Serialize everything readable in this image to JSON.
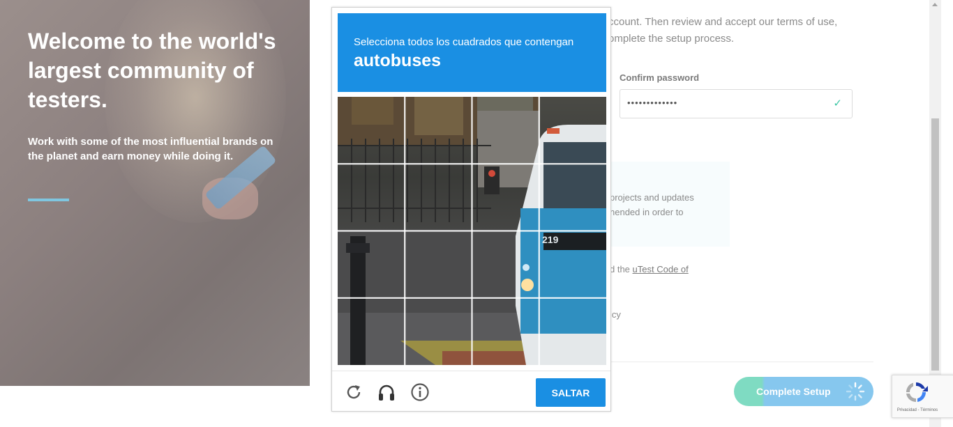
{
  "hero": {
    "title": "Welcome to the world's largest community of testers.",
    "subtitle": "Work with some of the most influential brands on the planet and earn money while doing it."
  },
  "form": {
    "intro_line1": "ccount. Then review and accept our terms of use,",
    "intro_line2": "omplete the setup process.",
    "confirm_password_label": "Confirm password",
    "confirm_password_value": "•••••••••••••",
    "info_line1": "projects and updates",
    "info_line2": "nended in order to",
    "code_prefix": "d the ",
    "code_link": "uTest Code of",
    "policy_text": "icy",
    "complete_button": "Complete Setup"
  },
  "captcha": {
    "instruction": "Selecciona todos los cuadrados que contengan",
    "target": "autobuses",
    "skip_button": "SALTAR",
    "bus_number": "219"
  },
  "badge": {
    "terms": "Privacidad - Términos"
  },
  "colors": {
    "captcha_blue": "#1a8fe3",
    "accent_teal": "#7fdbc2",
    "accent_blue": "#86c7ee",
    "hero_bar": "#7fc6e0"
  },
  "icons": [
    "check-icon",
    "spinner-icon",
    "reload-icon",
    "headphones-icon",
    "info-icon",
    "recaptcha-logo-icon"
  ]
}
